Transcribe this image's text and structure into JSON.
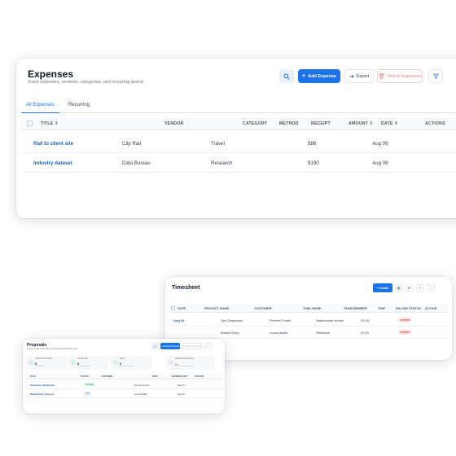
{
  "expenses": {
    "title": "Expenses",
    "subtitle": "Track expenses, vendors, categories, and recurring spend.",
    "search_icon": "search-icon",
    "add_label": "Add Expense",
    "export_label": "Export",
    "delete_label": "Delete Expenses",
    "tabs": [
      "All Expenses",
      "Recurring"
    ],
    "columns": {
      "title": "TITLE",
      "vendor": "VENDOR",
      "category": "CATEGORY",
      "method": "METHOD",
      "receipt": "RECEIPT",
      "amount": "AMOUNT",
      "date": "DATE",
      "actions": "ACTIONS"
    },
    "rows": [
      {
        "title": "Rail to client site",
        "vendor": "City Rail",
        "category": "Travel",
        "amount": "$86",
        "date": "Aug 06"
      },
      {
        "title": "Industry dataset",
        "vendor": "Data Bureau",
        "category": "Research",
        "amount": "$190",
        "date": "Aug 08"
      }
    ],
    "colors": {
      "accent": "#1a73e8",
      "link": "#1a5fc2"
    }
  },
  "timesheet": {
    "title": "Timesheet",
    "create_label": "+ Create",
    "columns": {
      "date": "DATE",
      "project": "PROJECT NAME",
      "customer": "CUSTOMER",
      "task": "TASK NAME",
      "member": "TEAM MEMBER",
      "time": "TIME",
      "billing": "BILLING STATUS",
      "action": "ACTION"
    },
    "rows": [
      {
        "date": "Aug 04",
        "project": "Ops Diagnostic",
        "customer": "Pioneer Foods",
        "task": "Stakeholder review",
        "time": "03:15",
        "billing": "Unbilled"
      },
      {
        "date": "",
        "project": "Market Entry",
        "customer": "Luma Health",
        "task": "Research",
        "time": "02:00",
        "billing": "Unbilled"
      }
    ]
  },
  "proposals": {
    "title": "Proposals",
    "subtitle": "Create, send, track and convert proposals into invoices",
    "create_label": "+ Create Proposal",
    "delete_label": "Delete Proposals",
    "stats": [
      {
        "label": "OPEN PROPOSALS",
        "value": "0",
        "sub": "Last 30 days"
      },
      {
        "label": "ACCEPTED",
        "value": "0",
        "sub": "0% of proposals"
      },
      {
        "label": "SENT",
        "value": "2",
        "sub": "Sent to customers"
      },
      {
        "label": "PENDING APPROVAL",
        "value": "—",
        "sub": "Awaiting a final decision"
      }
    ],
    "columns": {
      "title": "TITLE",
      "status": "STATUS",
      "customer": "CUSTOMER",
      "date": "DATE",
      "expiry": "EXPIRING DATE",
      "actions": "ACTIONS"
    },
    "rows": [
      {
        "title": "Operations Diagnostic",
        "status": "Accepted",
        "customer": "Pioneer Foods",
        "date": "Sep 01"
      },
      {
        "title": "Market Entry Advisory",
        "status": "Sent",
        "customer": "Luma Health",
        "date": "Sep 03"
      }
    ]
  }
}
